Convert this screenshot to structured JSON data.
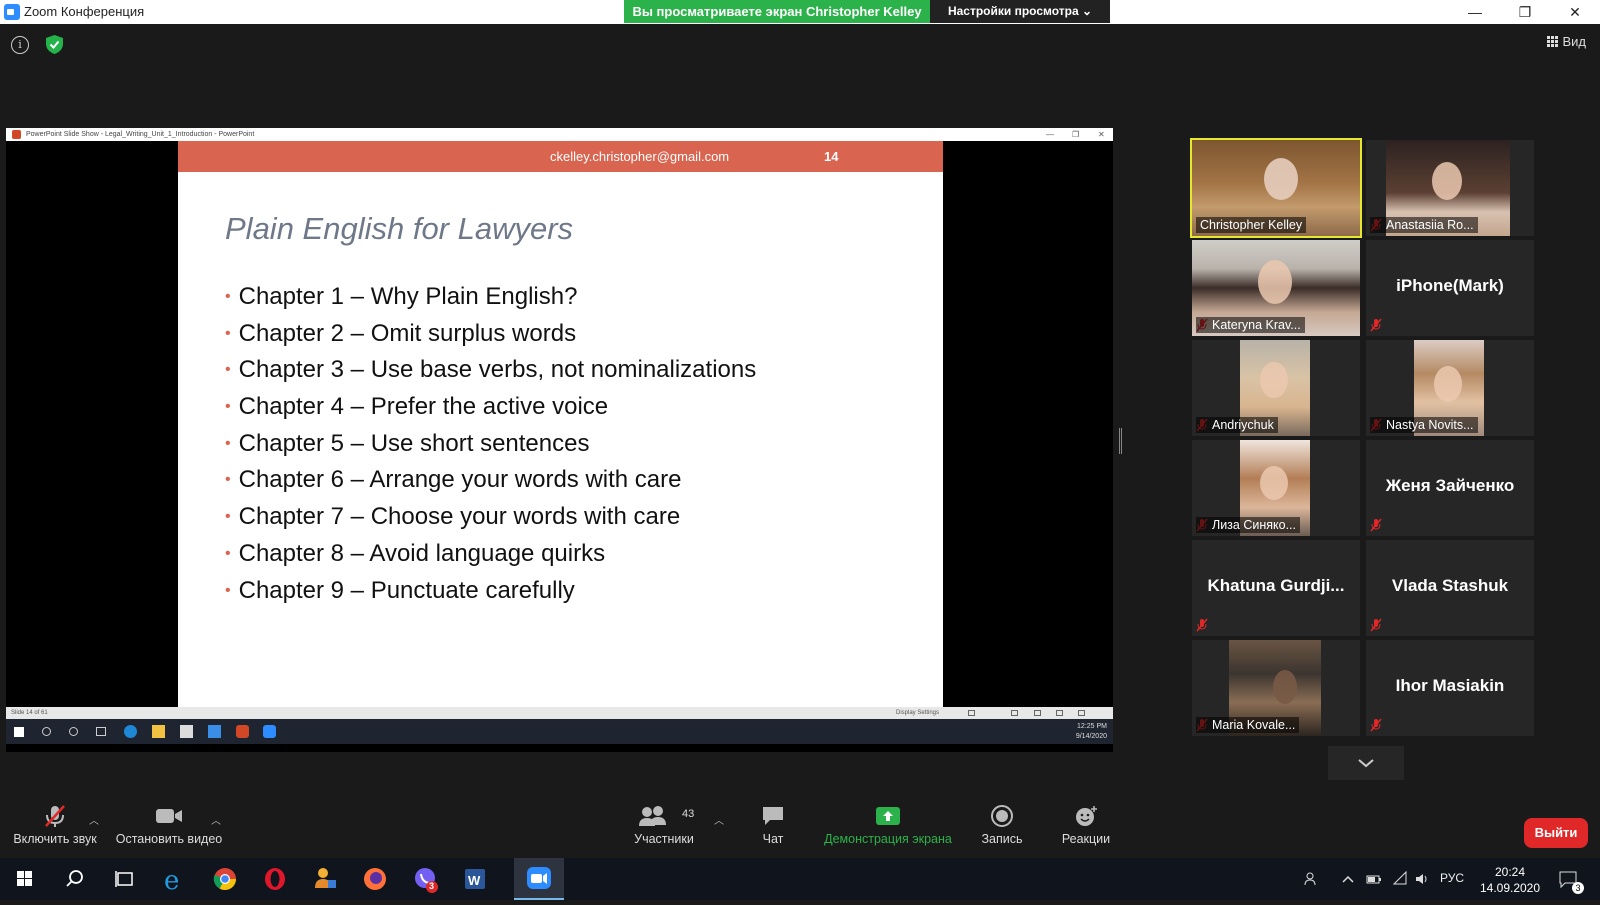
{
  "window": {
    "title": "Zoom Конференция",
    "share_banner": "Вы просматриваете экран Christopher Kelley",
    "view_settings": "Настройки просмотра ⌄",
    "view_button": "Вид"
  },
  "ppt": {
    "window_title": "PowerPoint Slide Show  -  Legal_Writing_Unit_1_Introduction  -  PowerPoint",
    "status_left": "Slide 14 of 61",
    "display_settings": "Display Settings",
    "clock_time": "12:25 PM",
    "clock_date": "9/14/2020"
  },
  "slide": {
    "email": "ckelley.christopher@gmail.com",
    "number": "14",
    "heading": "Plain English for Lawyers",
    "items": [
      "Chapter 1 – Why Plain English?",
      "Chapter 2 – Omit surplus words",
      "Chapter 3 – Use base verbs, not nominalizations",
      "Chapter 4 – Prefer the active voice",
      "Chapter 5 – Use short sentences",
      "Chapter 6 – Arrange your words with care",
      "Chapter 7 – Choose your words with care",
      "Chapter 8 – Avoid language quirks",
      "Chapter 9 – Punctuate carefully"
    ]
  },
  "participants": [
    {
      "name": "Christopher Kelley",
      "video": true,
      "muted": false,
      "speaking": true
    },
    {
      "name": "Anastasiia Ro...",
      "video": true,
      "muted": true
    },
    {
      "name": "Kateryna Krav...",
      "video": true,
      "muted": true
    },
    {
      "name": "iPhone(Mark)",
      "video": false,
      "muted": true
    },
    {
      "name": "Andriychuk",
      "video": true,
      "muted": true
    },
    {
      "name": "Nastya Novits...",
      "video": true,
      "muted": true
    },
    {
      "name": "Лиза Синяко...",
      "video": true,
      "muted": true
    },
    {
      "name": "Женя Зайченко",
      "video": false,
      "muted": true
    },
    {
      "name": "Khatuna  Gurdji...",
      "video": false,
      "muted": true
    },
    {
      "name": "Vlada Stashuk",
      "video": false,
      "muted": true
    },
    {
      "name": "Maria Kovale...",
      "video": true,
      "muted": true
    },
    {
      "name": "Ihor Masiakin",
      "video": false,
      "muted": true
    }
  ],
  "toolbar": {
    "unmute": "Включить звук",
    "stop_video": "Остановить видео",
    "participants": "Участники",
    "participants_count": "43",
    "chat": "Чат",
    "share_screen": "Демонстрация экрана",
    "record": "Запись",
    "reactions": "Реакции",
    "leave": "Выйти"
  },
  "taskbar": {
    "time": "20:24",
    "date": "14.09.2020",
    "language": "РУС",
    "notifications": "3",
    "viber_badge": "3"
  },
  "colors": {
    "share_green": "#2cb24a",
    "slide_header": "#d9644f",
    "speaker_outline": "#e6e82e",
    "leave_red": "#e02828",
    "zoom_blue": "#2d8cff"
  }
}
